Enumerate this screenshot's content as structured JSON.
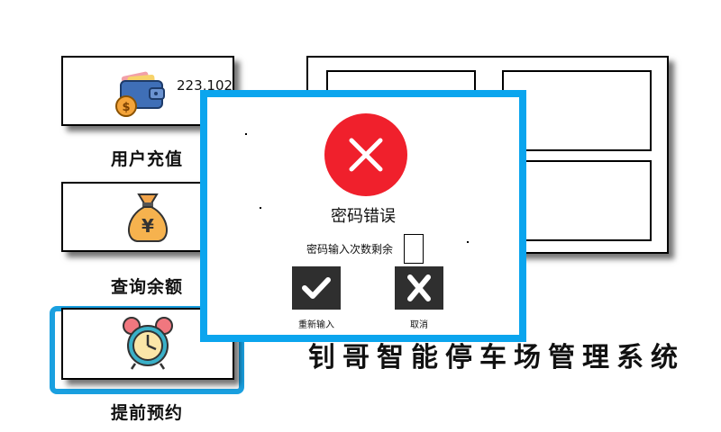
{
  "menu": {
    "recharge": {
      "label": "用户充值",
      "balance": "223,102",
      "icon": "wallet-icon"
    },
    "query": {
      "label": "查询余额",
      "icon": "money-bag-icon"
    },
    "reserve": {
      "label": "提前预约",
      "icon": "alarm-clock-icon"
    }
  },
  "system_title": "钊哥智能停车场管理系统",
  "dialog": {
    "icon": "error-icon",
    "message": "密码错误",
    "remaining_label": "密码输入次数剩余",
    "remaining_value": "",
    "retry_label": "重新输入",
    "cancel_label": "取消"
  },
  "colors": {
    "accent": "#1aa0e0",
    "error": "#f0202c",
    "button": "#2f2f2f"
  }
}
